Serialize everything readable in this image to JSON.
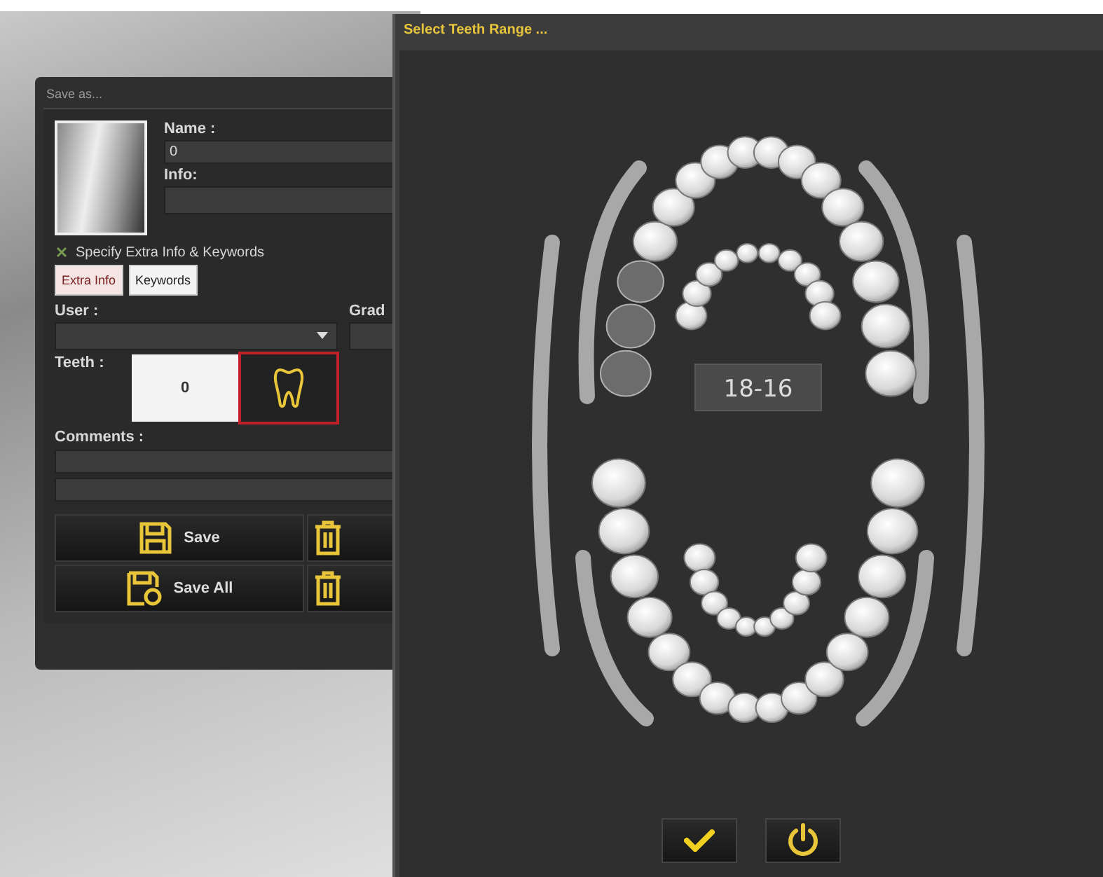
{
  "save_dialog": {
    "title": "Save as...",
    "name_label": "Name :",
    "name_value": "0",
    "info_label": "Info:",
    "extra_checkbox": {
      "label": "Specify Extra Info & Keywords",
      "checked": true
    },
    "tabs": [
      {
        "label": "Extra Info",
        "selected": true
      },
      {
        "label": "Keywords",
        "selected": false
      }
    ],
    "user_label": "User :",
    "grade_label": "Grad",
    "teeth_label": "Teeth :",
    "teeth_value": "0",
    "teeth_button": {
      "highlighted": true
    },
    "comments_label": "Comments :",
    "buttons": [
      {
        "kind": "save",
        "label": "Save"
      },
      {
        "kind": "delete"
      },
      {
        "kind": "save-all",
        "label": "Save All"
      },
      {
        "kind": "delete-all"
      }
    ]
  },
  "teeth_dialog": {
    "title": "Select Teeth Range ...",
    "range_label": "18-16",
    "upper_teeth": [
      {
        "selected": true
      },
      {
        "selected": true
      },
      {
        "selected": true
      },
      {
        "selected": false
      },
      {
        "selected": false
      },
      {
        "selected": false
      },
      {
        "selected": false
      },
      {
        "selected": false
      },
      {
        "selected": false
      },
      {
        "selected": false
      },
      {
        "selected": false
      },
      {
        "selected": false
      },
      {
        "selected": false
      },
      {
        "selected": false
      },
      {
        "selected": false
      },
      {
        "selected": false
      }
    ],
    "lower_teeth": [
      {
        "selected": false
      },
      {
        "selected": false
      },
      {
        "selected": false
      },
      {
        "selected": false
      },
      {
        "selected": false
      },
      {
        "selected": false
      },
      {
        "selected": false
      },
      {
        "selected": false
      },
      {
        "selected": false
      },
      {
        "selected": false
      },
      {
        "selected": false
      },
      {
        "selected": false
      },
      {
        "selected": false
      },
      {
        "selected": false
      },
      {
        "selected": false
      },
      {
        "selected": false
      }
    ]
  }
}
